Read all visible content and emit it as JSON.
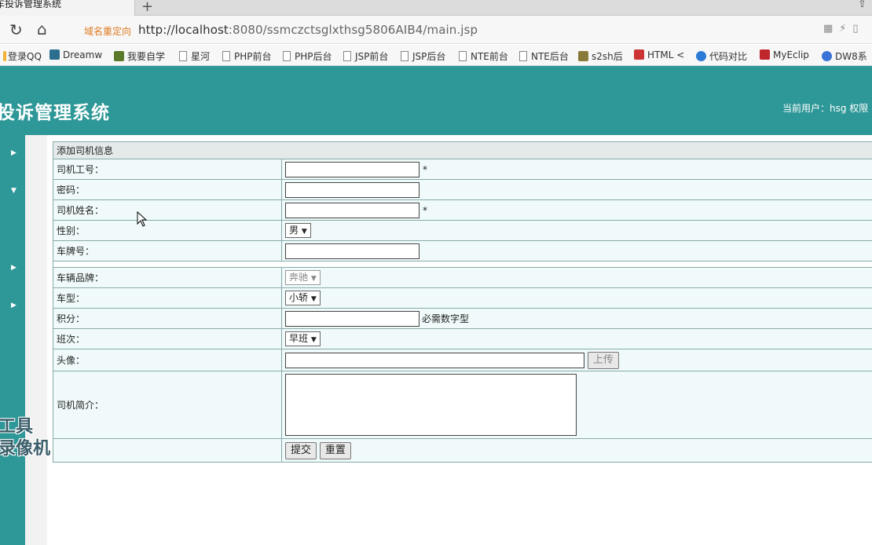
{
  "browser": {
    "tab_title": "车投诉管理系统",
    "new_tab": "+",
    "redirect_label": "域名重定向",
    "url_host": "http://localhost",
    "url_rest": ":8080/ssmczctsglxthsg5806AIB4/main.jsp",
    "bookmarks": [
      "登录QQ",
      "Dreamw",
      "我要自学",
      "星河",
      "PHP前台",
      "PHP后台",
      "JSP前台",
      "JSP后台",
      "NTE前台",
      "NTE后台",
      "s2sh后",
      "HTML <",
      "代码对比",
      "MyEclip",
      "DW8系"
    ]
  },
  "app": {
    "system_name": "投诉管理系统",
    "user_info": "当前用户：hsg  权限"
  },
  "watermark": [
    "工具",
    "录像机"
  ],
  "form": {
    "title": "添加司机信息",
    "labels": {
      "worker_id": "司机工号：",
      "password": "密码：",
      "driver_name": "司机姓名：",
      "gender": "性别：",
      "plate": "车牌号：",
      "brand": "车辆品牌：",
      "car_type": "车型：",
      "points": "积分：",
      "shift": "班次：",
      "avatar": "头像：",
      "intro": "司机简介："
    },
    "required_mark": "*",
    "points_hint": "必需数字型",
    "gender_value": "男",
    "brand_value": "奔驰",
    "car_type_value": "小轿",
    "shift_value": "早班",
    "upload_label": "上传",
    "submit_label": "提交",
    "reset_label": "重置"
  }
}
